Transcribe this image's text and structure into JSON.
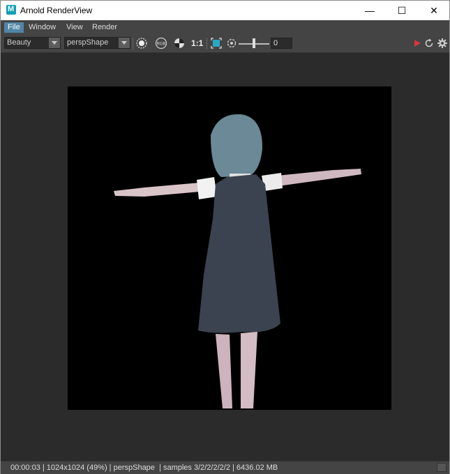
{
  "window": {
    "title": "Arnold RenderView",
    "app_icon_letter": "M",
    "controls": {
      "minimize": "—",
      "maximize": "☐",
      "close": "✕"
    }
  },
  "menu": {
    "items": [
      "File",
      "Window",
      "View",
      "Render"
    ]
  },
  "toolbar": {
    "aov_select": "Beauty",
    "camera_select": "perspShape",
    "ratio_label": "1:1",
    "exposure_value": "0",
    "icons": [
      "radial-icon",
      "rgb-icon",
      "checker-icon",
      "crop-region-icon",
      "exposure-icon",
      "play-icon",
      "refresh-icon",
      "settings-icon"
    ],
    "rgb_icon_text": "RGB",
    "accent_red": "#d9363e"
  },
  "status": {
    "text": "00:00:03 | 1024x1024 (49%) | perspShape  | samples 3/2/2/2/2/2 | 6436.02 MB"
  }
}
